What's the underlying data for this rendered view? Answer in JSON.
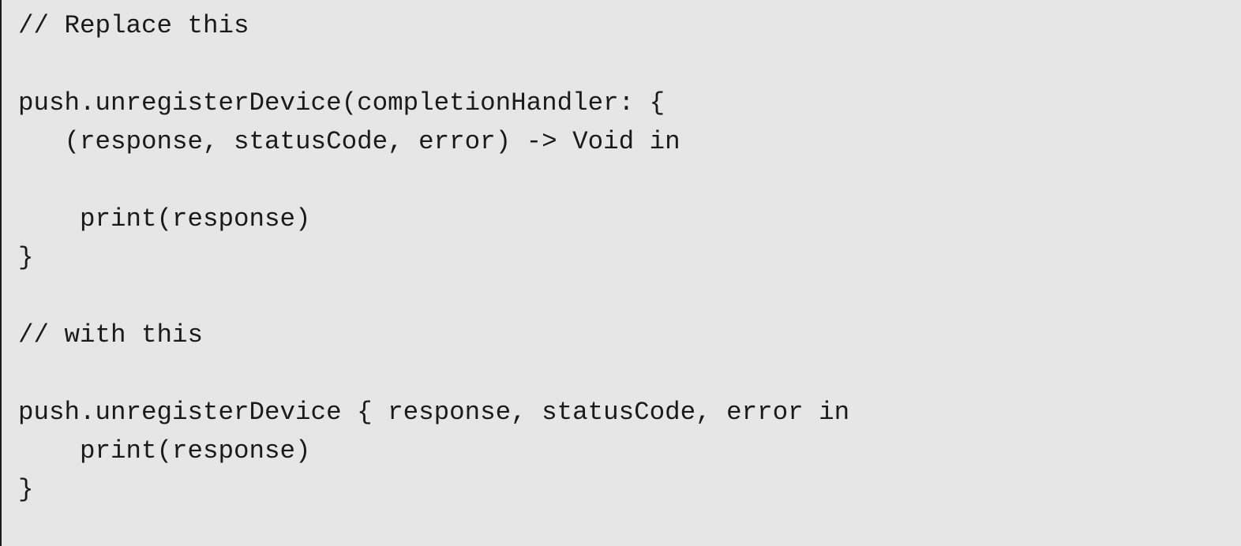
{
  "code": {
    "lines": [
      "// Replace this",
      "",
      "push.unregisterDevice(completionHandler: {",
      "   (response, statusCode, error) -> Void in",
      "",
      "    print(response)",
      "}",
      "",
      "// with this",
      "",
      "push.unregisterDevice { response, statusCode, error in",
      "    print(response)",
      "}"
    ]
  }
}
